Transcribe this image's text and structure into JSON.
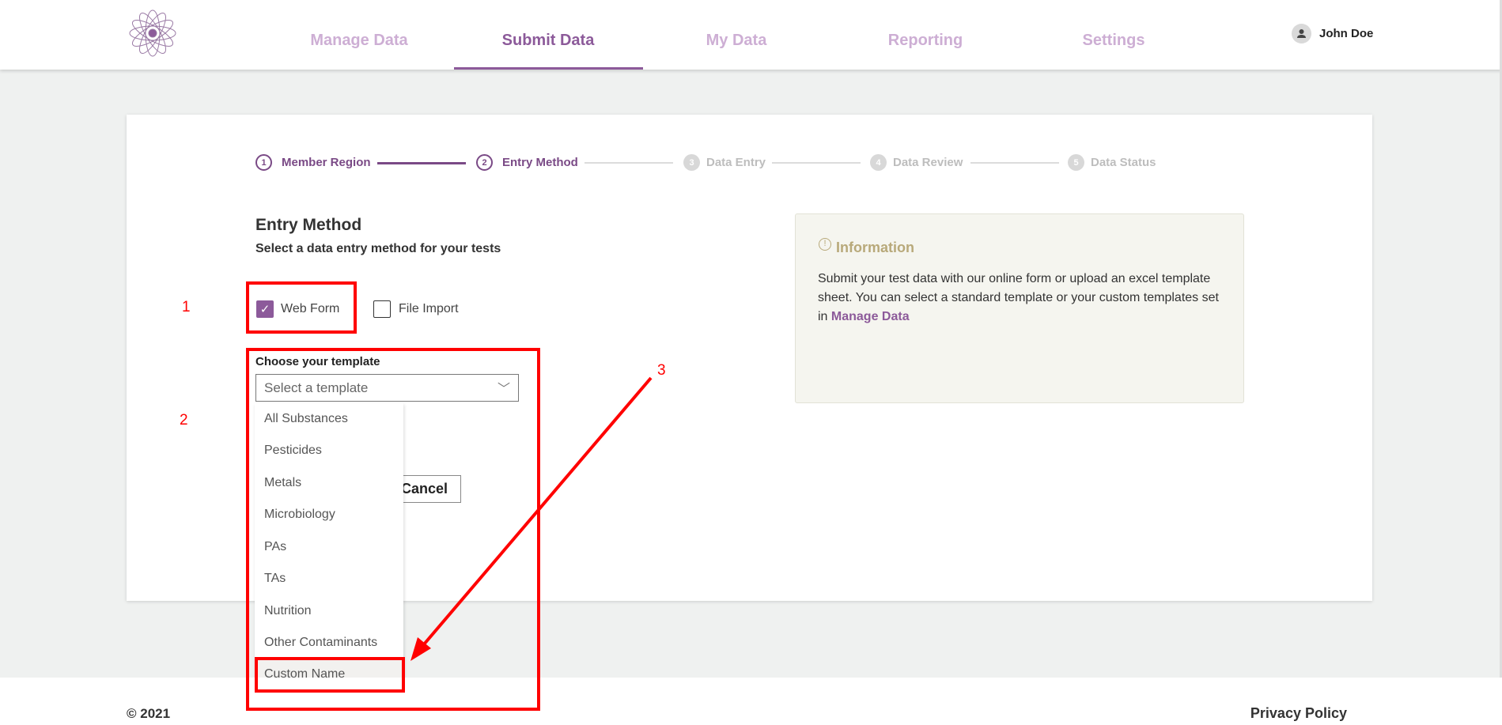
{
  "header": {
    "nav": [
      {
        "label": "Manage Data",
        "active": false
      },
      {
        "label": "Submit Data",
        "active": true
      },
      {
        "label": "My Data",
        "active": false
      },
      {
        "label": "Reporting",
        "active": false
      },
      {
        "label": "Settings",
        "active": false
      }
    ],
    "user": "John Doe",
    "accent": "#8c5a9a"
  },
  "stepper": [
    {
      "num": "1",
      "label": "Member Region",
      "state": "done"
    },
    {
      "num": "2",
      "label": "Entry Method",
      "state": "current"
    },
    {
      "num": "3",
      "label": "Data Entry",
      "state": "todo"
    },
    {
      "num": "4",
      "label": "Data Review",
      "state": "todo"
    },
    {
      "num": "5",
      "label": "Data Status",
      "state": "todo"
    }
  ],
  "form": {
    "title": "Entry Method",
    "subtitle": "Select a data entry method for your tests",
    "methods": [
      {
        "label": "Web Form",
        "checked": true
      },
      {
        "label": "File Import",
        "checked": false
      }
    ],
    "template_label": "Choose your template",
    "template_placeholder": "Select a template",
    "options": [
      "All Substances",
      "Pesticides",
      "Metals",
      "Microbiology",
      "PAs",
      "TAs",
      "Nutrition",
      "Other Contaminants",
      "Custom Name"
    ],
    "highlighted_option": "Custom Name",
    "cancel": "Cancel"
  },
  "info": {
    "title": "Information",
    "text": "Submit your test data with our online form or upload an excel template sheet. You can select a standard template or your custom templates set in ",
    "link": "Manage Data"
  },
  "footer": {
    "copyright": "©  2021",
    "privacy": "Privacy Policy"
  },
  "annotations": {
    "n1": "1",
    "n2": "2",
    "n3": "3",
    "color": "#ff0000"
  }
}
